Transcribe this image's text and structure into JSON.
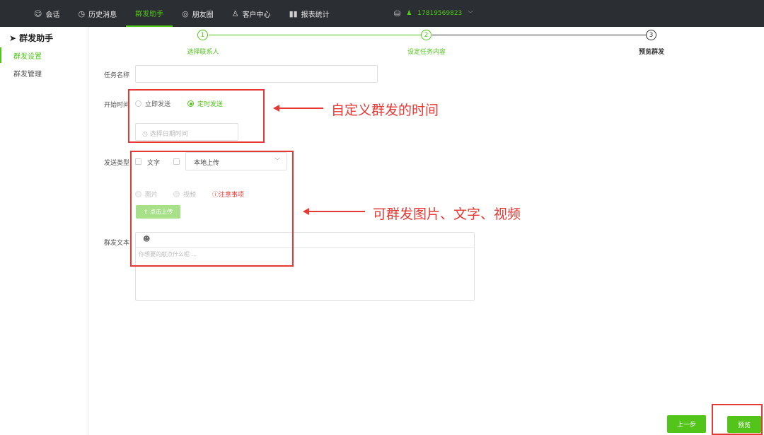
{
  "topnav": {
    "items": [
      {
        "icon": "chat-icon",
        "glyph": "☺",
        "label": "会话"
      },
      {
        "icon": "history-icon",
        "glyph": "◷",
        "label": "历史消息"
      },
      {
        "icon": "",
        "glyph": "",
        "label": "群发助手"
      },
      {
        "icon": "moments-icon",
        "glyph": "◎",
        "label": "朋友圈"
      },
      {
        "icon": "customer-icon",
        "glyph": "♙",
        "label": "客户中心"
      },
      {
        "icon": "stats-icon",
        "glyph": "▮▮",
        "label": "报表统计"
      }
    ],
    "active_index": 2,
    "account": "17819569823"
  },
  "sidebar": {
    "title": "群发助手",
    "items": [
      "群发设置",
      "群发管理"
    ]
  },
  "steps": [
    {
      "num": "1",
      "label": "选择联系人"
    },
    {
      "num": "2",
      "label": "设定任务内容"
    },
    {
      "num": "3",
      "label": "预览群发"
    }
  ],
  "form": {
    "task_name_label": "任务名称",
    "start_time_label": "开始时间",
    "radio_now": "立即发送",
    "radio_scheduled": "定时发送",
    "date_placeholder": "◷ 选择日期时间",
    "send_type_label": "发送类型",
    "type_text": "文字",
    "upload_select": "本地上传",
    "media_image": "图片",
    "media_video": "视频",
    "notice": "ⓘ注意事项",
    "upload_button": "⇧ 点击上传",
    "text_label": "群发文本",
    "text_placeholder": "你想要的献点什么呢 ..."
  },
  "annotations": {
    "time": "自定义群发的时间",
    "content": "可群发图片、文字、视频"
  },
  "buttons": {
    "prev": "上一步",
    "preview": "预览"
  },
  "colors": {
    "accent": "#52c41a",
    "annotation": "#e53935",
    "topbar": "#2b2e33"
  }
}
